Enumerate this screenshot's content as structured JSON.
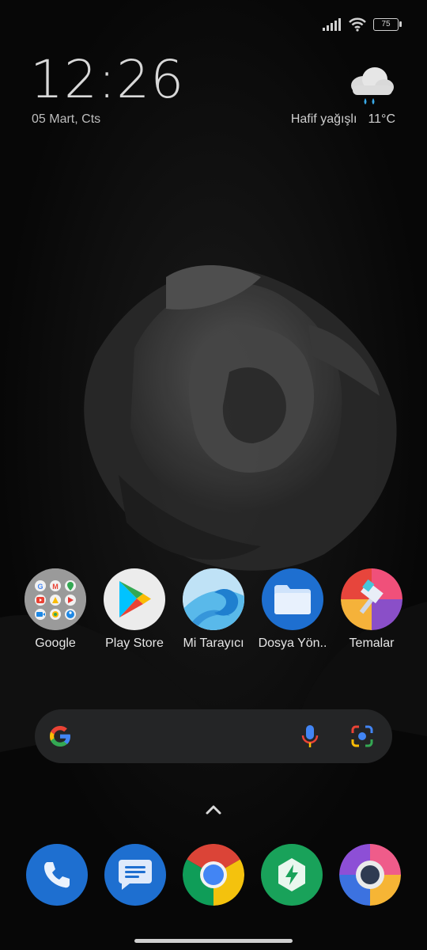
{
  "status": {
    "battery": "75"
  },
  "clock": {
    "time": "12:26",
    "date": "05 Mart, Cts"
  },
  "weather": {
    "condition": "Hafif yağışlı",
    "temperature": "11°C",
    "icon": "rain-cloud-icon"
  },
  "apps": [
    {
      "label": "Google",
      "icon": "google-folder-icon"
    },
    {
      "label": "Play Store",
      "icon": "play-store-icon"
    },
    {
      "label": "Mi Tarayıcı",
      "icon": "mi-browser-icon"
    },
    {
      "label": "Dosya Yön..",
      "icon": "file-manager-icon"
    },
    {
      "label": "Temalar",
      "icon": "themes-icon"
    }
  ],
  "search": {
    "icon": "google-g-icon"
  },
  "dock": [
    {
      "icon": "phone-icon"
    },
    {
      "icon": "messages-icon"
    },
    {
      "icon": "chrome-icon"
    },
    {
      "icon": "security-icon"
    },
    {
      "icon": "browser-icon"
    }
  ]
}
